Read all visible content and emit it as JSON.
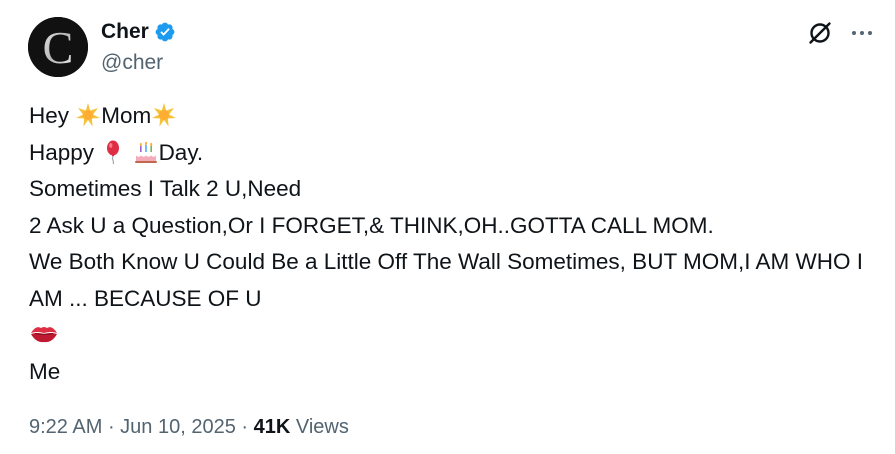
{
  "author": {
    "display_name": "Cher",
    "handle": "@cher",
    "verified_icon": "verified-badge-icon",
    "verified_color": "#1d9bf0",
    "avatar_letter": "C"
  },
  "actions": {
    "grok_icon": "grok-icon",
    "more_icon": "more-icon"
  },
  "tweet": {
    "line1": {
      "a": "Hey ",
      "b": "Mom",
      "emoji": "glowing-star"
    },
    "line2": {
      "a": "Happy ",
      "b": "Day.",
      "emoji1": "balloon",
      "emoji2": "birthday-cake"
    },
    "line3": "Sometimes I Talk 2 U,Need",
    "line4": "2 Ask U a Question,Or I FORGET,& THINK,OH..GOTTA CALL MOM.",
    "line5": "We Both Know U Could Be a Little Off The Wall Sometimes, BUT MOM,I AM WHO I AM ... BECAUSE OF U",
    "line6_emoji": "kiss-mark",
    "line7": "Me"
  },
  "meta": {
    "time": "9:22 AM",
    "separator": " · ",
    "date": "Jun 10, 2025",
    "views_count": "41K",
    "views_label": " Views"
  },
  "colors": {
    "text": "#0f1419",
    "secondary": "#536471",
    "accent": "#1d9bf0"
  }
}
